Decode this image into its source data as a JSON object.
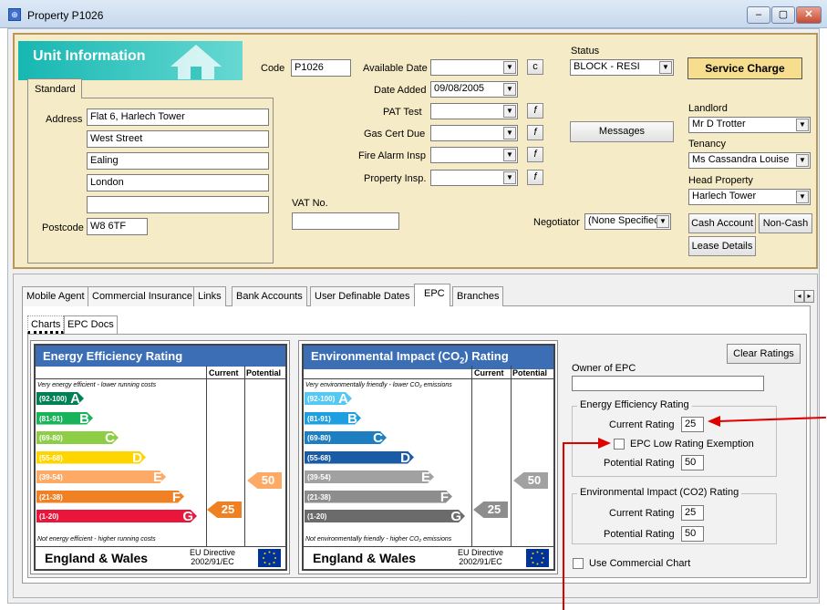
{
  "window": {
    "title": "Property P1026",
    "buttons": [
      "–",
      "▢",
      "✕"
    ]
  },
  "unit": {
    "banner": "Unit Information",
    "tab": "Standard",
    "address_label": "Address",
    "address": [
      "Flat 6, Harlech Tower",
      "West Street",
      "Ealing",
      "London",
      ""
    ],
    "postcode_label": "Postcode",
    "postcode": "W8 6TF",
    "code_label": "Code",
    "code": "P1026",
    "available_date_label": "Available Date",
    "available_date": "",
    "c_btn": "c",
    "date_added_label": "Date Added",
    "date_added": "09/08/2005",
    "pat_label": "PAT Test",
    "gas_label": "Gas Cert Due",
    "fire_label": "Fire Alarm Insp",
    "prop_label": "Property Insp.",
    "f_btn": "f",
    "vat_label": "VAT No.",
    "vat": "",
    "status_label": "Status",
    "status": "BLOCK - RESI",
    "service_btn": "Service Charge",
    "messages_btn": "Messages",
    "negotiator_label": "Negotiator",
    "negotiator": "(None Specifiec",
    "landlord_label": "Landlord",
    "landlord": "Mr D Trotter",
    "tenancy_label": "Tenancy",
    "tenancy": "Ms Cassandra Louise",
    "head_label": "Head Property",
    "head": "Harlech Tower",
    "cash_btn": "Cash Account",
    "noncash_btn": "Non-Cash",
    "lease_btn": "Lease Details"
  },
  "tabs": [
    "Mobile Agent",
    "Commercial Insurance",
    "Links",
    "Bank Accounts",
    "User Definable Dates",
    "EPC",
    "Branches"
  ],
  "subtabs": [
    "Charts",
    "EPC Docs"
  ],
  "scroll": [
    "◂",
    "▸"
  ],
  "ee_chart": {
    "title": "Energy Efficiency Rating",
    "current_col": "Current",
    "potential_col": "Potential",
    "top_note": "Very energy efficient - lower running costs",
    "bottom_note": "Not energy efficient - higher running costs",
    "bands": [
      {
        "range": "(92-100)",
        "letter": "A",
        "color": "#008054"
      },
      {
        "range": "(81-91)",
        "letter": "B",
        "color": "#19b459"
      },
      {
        "range": "(69-80)",
        "letter": "C",
        "color": "#8dce46"
      },
      {
        "range": "(55-68)",
        "letter": "D",
        "color": "#ffd500"
      },
      {
        "range": "(39-54)",
        "letter": "E",
        "color": "#fcaa65"
      },
      {
        "range": "(21-38)",
        "letter": "F",
        "color": "#ef8023"
      },
      {
        "range": "(1-20)",
        "letter": "G",
        "color": "#e9153b"
      }
    ],
    "current": "25",
    "potential": "50",
    "footer": "England & Wales",
    "directive": "EU Directive\n2002/91/EC"
  },
  "ei_chart": {
    "title": "Environmental Impact (CO",
    "title_sub": "2",
    "title_end": ") Rating",
    "current_col": "Current",
    "potential_col": "Potential",
    "top_note": "Very environmentally friendly - lower CO₂ emissions",
    "bottom_note": "Not environmentally friendly - higher CO₂ emissions",
    "bands": [
      {
        "range": "(92-100)",
        "letter": "A",
        "color": "#55c9f2"
      },
      {
        "range": "(81-91)",
        "letter": "B",
        "color": "#1ea0e0"
      },
      {
        "range": "(69-80)",
        "letter": "C",
        "color": "#1d7fc1"
      },
      {
        "range": "(55-68)",
        "letter": "D",
        "color": "#1a5ba6"
      },
      {
        "range": "(39-54)",
        "letter": "E",
        "color": "#a1a1a1"
      },
      {
        "range": "(21-38)",
        "letter": "F",
        "color": "#8d8d8d"
      },
      {
        "range": "(1-20)",
        "letter": "G",
        "color": "#6b6b6b"
      }
    ],
    "current": "25",
    "potential": "50",
    "footer": "England & Wales",
    "directive": "EU Directive\n2002/91/EC"
  },
  "epc": {
    "clear_btn": "Clear Ratings",
    "owner_label": "Owner of EPC",
    "owner": "",
    "ee_group": "Energy Efficiency Rating",
    "ee_current_label": "Current Rating",
    "ee_current": "25",
    "exemption_label": "EPC Low Rating Exemption",
    "ee_potential_label": "Potential Rating",
    "ee_potential": "50",
    "ei_group": "Environmental Impact (CO2) Rating",
    "ei_current_label": "Current Rating",
    "ei_current": "25",
    "ei_potential_label": "Potential Rating",
    "ei_potential": "50",
    "commercial_label": "Use Commercial Chart"
  },
  "colors": {
    "arrow_red": "#e00000",
    "panel": "#f5ebc6"
  }
}
